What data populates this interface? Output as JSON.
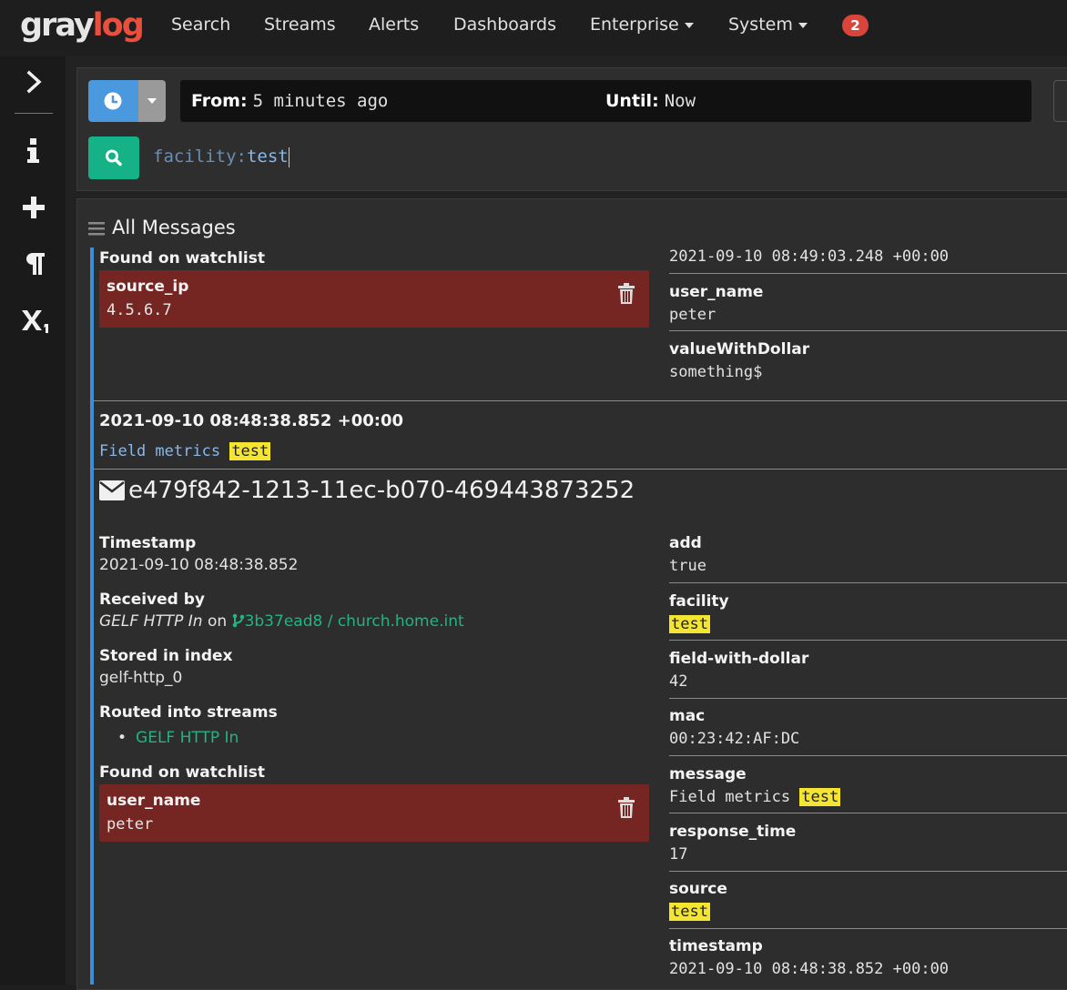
{
  "nav": {
    "logo_part1": "gray",
    "logo_part2": "log",
    "items": [
      "Search",
      "Streams",
      "Alerts",
      "Dashboards"
    ],
    "enterprise": "Enterprise",
    "system": "System",
    "notification_count": "2"
  },
  "search": {
    "from_label": "From:",
    "from_value": "5 minutes ago",
    "until_label": "Until:",
    "until_value": "Now",
    "query_key": "facility:",
    "query_value": "test"
  },
  "results": {
    "title": "All Messages",
    "msg1": {
      "watchlist_title": "Found on watchlist",
      "watchlist_key": "source_ip",
      "watchlist_value": "4.5.6.7",
      "timestamp": "2021-09-10 08:49:03.248 +00:00",
      "fields": [
        {
          "key": "user_name",
          "value": "peter"
        },
        {
          "key": "valueWithDollar",
          "value": "something$"
        }
      ]
    },
    "msg2": {
      "header_timestamp": "2021-09-10 08:48:38.852 +00:00",
      "summary_text": "Field metrics",
      "summary_highlight": "test",
      "message_id": "e479f842-1213-11ec-b070-469443873252",
      "timestamp_label": "Timestamp",
      "timestamp_value": "2021-09-10 08:48:38.852",
      "received_label": "Received by",
      "received_input": "GELF HTTP In",
      "received_on": "on",
      "received_node": "3b37ead8 / church.home.int",
      "index_label": "Stored in index",
      "index_value": "gelf-http_0",
      "streams_label": "Routed into streams",
      "stream": "GELF HTTP In",
      "watchlist_title": "Found on watchlist",
      "watchlist_key": "user_name",
      "watchlist_value": "peter",
      "fields": {
        "add": {
          "key": "add",
          "value": "true"
        },
        "facility": {
          "key": "facility",
          "value": "test"
        },
        "field_with_dollar": {
          "key": "field-with-dollar",
          "value": "42"
        },
        "mac": {
          "key": "mac",
          "value": "00:23:42:AF:DC"
        },
        "message": {
          "key": "message",
          "value": "Field metrics",
          "highlight": "test"
        },
        "response_time": {
          "key": "response_time",
          "value": "17"
        },
        "source": {
          "key": "source",
          "value": "test"
        },
        "timestamp": {
          "key": "timestamp",
          "value": "2021-09-10 08:48:38.852 +00:00"
        }
      }
    }
  },
  "icons": {
    "sidebar": [
      "chevron-right-icon",
      "info-icon",
      "plus-icon",
      "pilcrow-icon",
      "subscript-icon"
    ],
    "clock": "clock-icon",
    "search": "search-icon",
    "envelope": "envelope-icon",
    "trash": "trash-icon",
    "branch": "branch-icon",
    "hamburger": "hamburger-icon"
  },
  "colors": {
    "accent_blue": "#4a98dd",
    "search_green": "#16b287",
    "watchlist_red": "#752622",
    "highlight_yellow": "#f4e533",
    "logo_red": "#ea4e3c",
    "badge_red": "#d9443b"
  }
}
